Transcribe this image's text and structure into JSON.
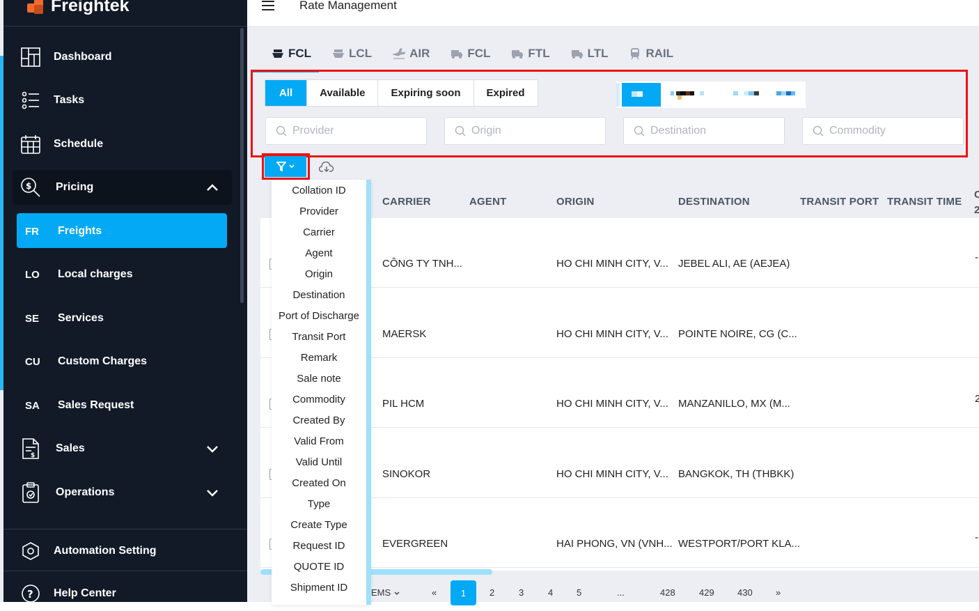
{
  "app": {
    "name": "Freightek"
  },
  "header": {
    "title": "Rate Management"
  },
  "sidebar": {
    "items": [
      {
        "label": "Dashboard",
        "icon": "dashboard-icon"
      },
      {
        "label": "Tasks",
        "icon": "tasks-icon"
      },
      {
        "label": "Schedule",
        "icon": "calendar-icon"
      },
      {
        "label": "Pricing",
        "icon": "pricing-icon"
      },
      {
        "label": "Sales",
        "icon": "sales-icon"
      },
      {
        "label": "Operations",
        "icon": "operations-icon"
      },
      {
        "label": "Automation Setting",
        "icon": "automation-icon"
      },
      {
        "label": "Help Center",
        "icon": "help-icon"
      }
    ],
    "pricing_sub": [
      {
        "abbr": "FR",
        "label": "Freights"
      },
      {
        "abbr": "LO",
        "label": "Local charges"
      },
      {
        "abbr": "SE",
        "label": "Services"
      },
      {
        "abbr": "CU",
        "label": "Custom Charges"
      },
      {
        "abbr": "SA",
        "label": "Sales Request"
      }
    ]
  },
  "tabs": [
    {
      "label": "FCL",
      "icon": "ship-icon"
    },
    {
      "label": "LCL",
      "icon": "ship-icon"
    },
    {
      "label": "AIR",
      "icon": "plane-icon"
    },
    {
      "label": "FCL",
      "icon": "truck-icon"
    },
    {
      "label": "FTL",
      "icon": "truck-icon"
    },
    {
      "label": "LTL",
      "icon": "truck-icon"
    },
    {
      "label": "RAIL",
      "icon": "train-icon"
    }
  ],
  "status_filter": [
    "All",
    "Available",
    "Expiring soon",
    "Expired"
  ],
  "search": {
    "provider": "Provider",
    "origin": "Origin",
    "destination": "Destination",
    "commodity": "Commodity"
  },
  "table": {
    "headers": [
      "CARRIER",
      "AGENT",
      "ORIGIN",
      "DESTINATION",
      "TRANSIT PORT",
      "TRANSIT TIME",
      "C",
      "2"
    ],
    "rows": [
      {
        "carrier": "CÔNG TY TNH...",
        "origin": "HO CHI MINH CITY, V...",
        "destination": "JEBEL ALI, AE (AEJEA)"
      },
      {
        "carrier": "MAERSK",
        "origin": "HO CHI MINH CITY, V...",
        "destination": "POINTE NOIRE, CG (C..."
      },
      {
        "carrier": "PIL HCM",
        "origin": "HO CHI MINH CITY, V...",
        "destination": "MANZANILLO, MX (M..."
      },
      {
        "carrier": "SINOKOR",
        "origin": "HO CHI MINH CITY, V...",
        "destination": "BANGKOK, TH (THBKK)"
      },
      {
        "carrier": "EVERGREEN",
        "origin": "HAI PHONG, VN (VNH...",
        "destination": "WESTPORT/PORT KLA..."
      }
    ],
    "edge_values": [
      "-",
      "",
      "2",
      "",
      "-"
    ]
  },
  "column_menu": [
    "Collation ID",
    "Provider",
    "Carrier",
    "Agent",
    "Origin",
    "Destination",
    "Port of Discharge",
    "Transit Port",
    "Remark",
    "Sale note",
    "Commodity",
    "Created By",
    "Valid From",
    "Valid Until",
    "Created On",
    "Type",
    "Create Type",
    "Request ID",
    "QUOTE ID",
    "Shipment ID"
  ],
  "pagination": {
    "items_label": "EMS",
    "prev": "«",
    "pages": [
      "1",
      "2",
      "3",
      "4",
      "5",
      "...",
      "428",
      "429",
      "430"
    ],
    "next": "»",
    "current": "1"
  },
  "colors": {
    "accent": "#03a9f4",
    "sidebar": "#121a27",
    "highlight": "#ee1111",
    "logo": "#f26b2d"
  }
}
